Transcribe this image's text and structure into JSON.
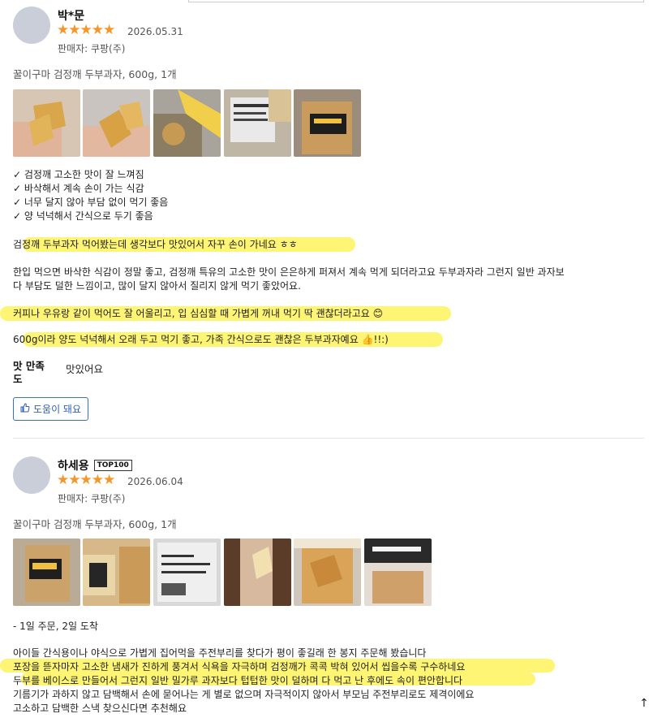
{
  "reviews": [
    {
      "name": "박*문",
      "stars": "★★★★★",
      "date": "2026.05.31",
      "seller": "판매자: 쿠팡(주)",
      "product": "꿀이구마 검정깨 두부과자, 600g, 1개",
      "checklist": [
        "✓ 검정깨 고소한 맛이 잘 느껴짐",
        "✓ 바삭해서 계속 손이 가는 식감",
        "✓ 너무 달지 않아 부담 없이 먹기 좋음",
        "✓ 양 넉넉해서 간식으로 두기 좋음"
      ],
      "paragraphs": [
        "검정깨 두부과자 먹어봤는데 생각보다 맛있어서 자꾸 손이 가네요 ㅎㅎ",
        "한입 먹으면 바삭한 식감이 정말 좋고, 검정깨 특유의 고소한 맛이 은은하게 퍼져서 계속 먹게 되더라고요 두부과자라 그런지 일반 과자보",
        "다 부담도 덜한 느낌이고, 많이 달지 않아서 질리지 않게 먹기 좋았어요.",
        "커피나 우유랑 같이 먹어도 잘 어울리고, 입 심심할 때 가볍게 꺼내 먹기 딱 괜찮더라고요 😊",
        "600g이라 양도 넉넉해서 오래 두고 먹기 좋고, 가족 간식으로도 괜찮은 두부과자예요 👍!!:)"
      ],
      "taste_label": "맛 만족도",
      "taste_value": "맛있어요",
      "helpful_label": "도움이 돼요"
    },
    {
      "name": "하세용",
      "badge": "TOP100",
      "stars": "★★★★★",
      "date": "2026.06.04",
      "seller": "판매자: 쿠팡(주)",
      "product": "꿀이구마 검정깨 두부과자, 600g, 1개",
      "lines": [
        "- 1일 주문, 2일 도착",
        "아이들 간식용이나 야식으로 가볍게 집어먹을 주전부리를 찾다가 평이 좋길래 한 봉지 주문해 봤습니다",
        "포장을 뜯자마자 고소한 냄새가 진하게 풍겨서 식욕을 자극하며 검정깨가 콕콕 박혀 있어서 씹을수록 구수하네요",
        "두부를 베이스로 만들어서 그런지 일반 밀가루 과자보다 텁텁한 맛이 덜하며 다 먹고 난 후에도 속이 편안합니다",
        "기름기가 과하지 않고 담백해서 손에 묻어나는 게 별로 없으며 자극적이지 않아서 부모님 주전부리로도 제격이에요",
        "고소하고 담백한 스낵 찾으신다면 추천해요"
      ]
    }
  ],
  "scroll_icon": "↑",
  "colors": {
    "star": "#f4962a",
    "highlight": "#fdf35a",
    "helpful_border": "#3a6fc6"
  }
}
